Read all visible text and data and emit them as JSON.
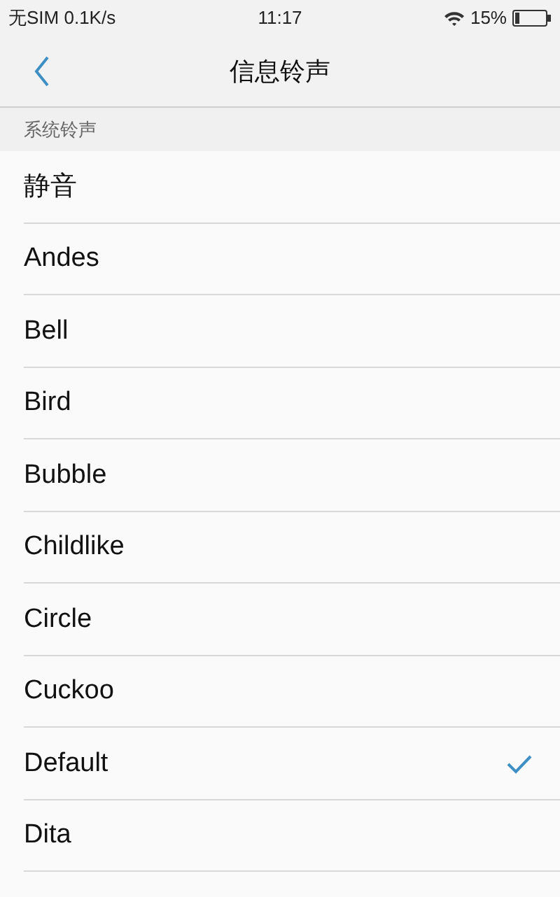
{
  "status_bar": {
    "carrier": "无SIM 0.1K/s",
    "time": "11:17",
    "battery_percent": "15%"
  },
  "header": {
    "title": "信息铃声"
  },
  "section": {
    "title": "系统铃声"
  },
  "ringtones": [
    {
      "label": "静音",
      "selected": false
    },
    {
      "label": "Andes",
      "selected": false
    },
    {
      "label": "Bell",
      "selected": false
    },
    {
      "label": "Bird",
      "selected": false
    },
    {
      "label": "Bubble",
      "selected": false
    },
    {
      "label": "Childlike",
      "selected": false
    },
    {
      "label": "Circle",
      "selected": false
    },
    {
      "label": "Cuckoo",
      "selected": false
    },
    {
      "label": "Default",
      "selected": true
    },
    {
      "label": "Dita",
      "selected": false
    }
  ]
}
